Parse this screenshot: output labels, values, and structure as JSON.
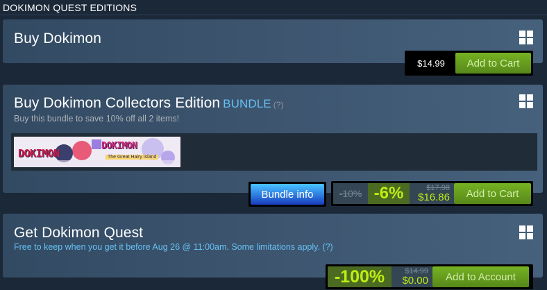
{
  "section": {
    "title": "DOKIMON QUEST EDITIONS"
  },
  "items": [
    {
      "title": "Buy Dokimon",
      "price": "$14.99",
      "button": "Add to Cart"
    },
    {
      "title": "Buy Dokimon Collectors Edition",
      "bundle_word": "BUNDLE",
      "help": "(?)",
      "description": "Buy this bundle to save 10% off all 2 items!",
      "capsule_text_1": "DOKIMON",
      "capsule_text_2": "DOKIMON",
      "capsule_text_3": "The Great Hairy Island",
      "bundle_info_button": "Bundle info",
      "bundle_discount": "-10%",
      "discount": "-6%",
      "original_price": "$17.98",
      "final_price": "$16.86",
      "button": "Add to Cart"
    },
    {
      "title": "Get Dokimon Quest",
      "promo": "Free to keep when you get it before Aug 26 @ 11:00am. Some limitations apply. (?)",
      "discount": "-100%",
      "original_price": "$14.99",
      "final_price": "$0.00",
      "button": "Add to Account"
    }
  ],
  "colors": {
    "page_bg": "#1b2838",
    "accent_blue": "#67c1f5",
    "discount_green": "#beee11",
    "cart_green": "#75b022"
  },
  "icons": {
    "platform": "windows-icon"
  }
}
